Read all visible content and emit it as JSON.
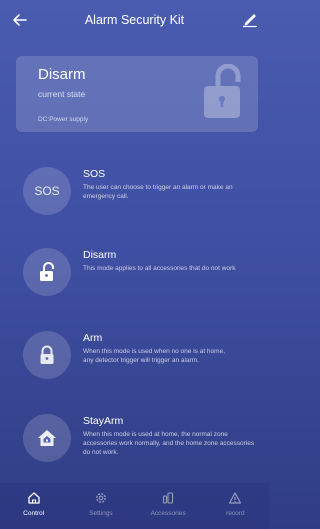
{
  "header": {
    "title": "Alarm Security Kit",
    "back_icon": "arrow-left-icon",
    "edit_icon": "pencil-icon"
  },
  "status_card": {
    "state": "Disarm",
    "state_caption": "current state",
    "power": "DC:Power supply",
    "icon": "unlocked-padlock-icon"
  },
  "modes": [
    {
      "icon": "sos-icon",
      "icon_text": "SOS",
      "title": "SOS",
      "description": "The user can choose to trigger an alarm or make an emergency call."
    },
    {
      "icon": "unlock-icon",
      "title": "Disarm",
      "description": "This mode applies to all accessories that do not work"
    },
    {
      "icon": "lock-icon",
      "title": "Arm",
      "description": "When this mode is used when no one is at home,\nany detector trigger will trigger an alarm."
    },
    {
      "icon": "home-shield-icon",
      "title": "StayArm",
      "description": "When this mode is used at home, the normal zone accessories work normally, and the home zone accessories do not work."
    }
  ],
  "tabbar": {
    "active": "Control",
    "tabs": [
      {
        "label": "Control",
        "icon": "home-icon"
      },
      {
        "label": "Settings",
        "icon": "gear-icon"
      },
      {
        "label": "Accessories",
        "icon": "devices-icon"
      },
      {
        "label": "record",
        "icon": "warning-icon"
      }
    ]
  }
}
